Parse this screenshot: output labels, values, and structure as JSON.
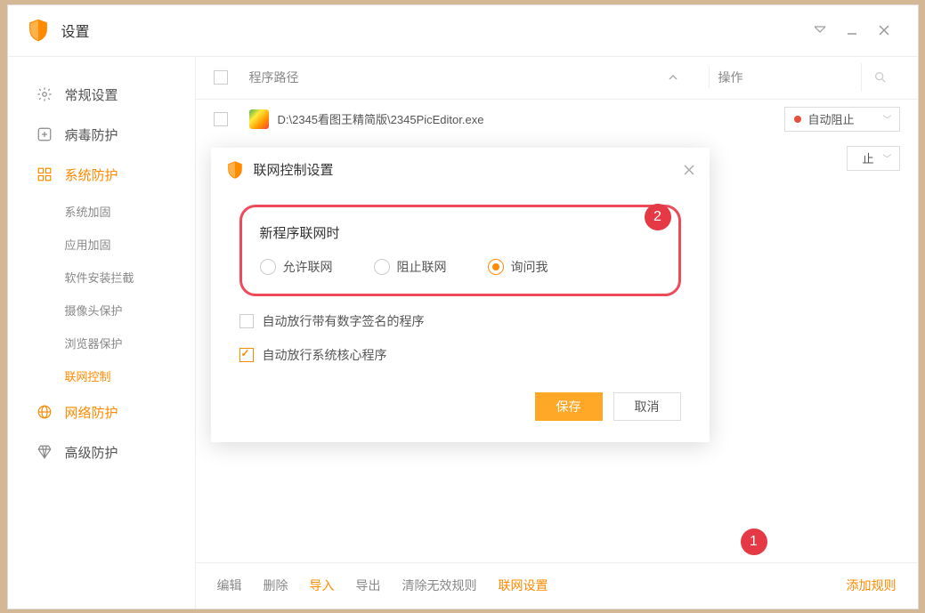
{
  "window": {
    "title": "设置"
  },
  "sidebar": {
    "items": [
      {
        "label": "常规设置"
      },
      {
        "label": "病毒防护"
      },
      {
        "label": "系统防护"
      },
      {
        "label": "网络防护"
      },
      {
        "label": "高级防护"
      }
    ],
    "subs": [
      {
        "label": "系统加固"
      },
      {
        "label": "应用加固"
      },
      {
        "label": "软件安装拦截"
      },
      {
        "label": "摄像头保护"
      },
      {
        "label": "浏览器保护"
      },
      {
        "label": "联网控制"
      }
    ]
  },
  "table": {
    "head": {
      "path": "程序路径",
      "op": "操作"
    },
    "rows": [
      {
        "path": "D:\\2345看图王精简版\\2345PicEditor.exe",
        "action": "自动阻止",
        "dot": "#e74c3c"
      },
      {
        "action_tail": "止"
      }
    ]
  },
  "toolbar": {
    "edit": "编辑",
    "delete": "删除",
    "import": "导入",
    "export": "导出",
    "clear": "清除无效规则",
    "net": "联网设置",
    "add": "添加规则"
  },
  "modal": {
    "title": "联网控制设置",
    "section": "新程序联网时",
    "options": [
      {
        "label": "允许联网"
      },
      {
        "label": "阻止联网"
      },
      {
        "label": "询问我"
      }
    ],
    "check1": "自动放行带有数字签名的程序",
    "check2": "自动放行系统核心程序",
    "save": "保存",
    "cancel": "取消"
  },
  "badges": {
    "one": "1",
    "two": "2"
  }
}
